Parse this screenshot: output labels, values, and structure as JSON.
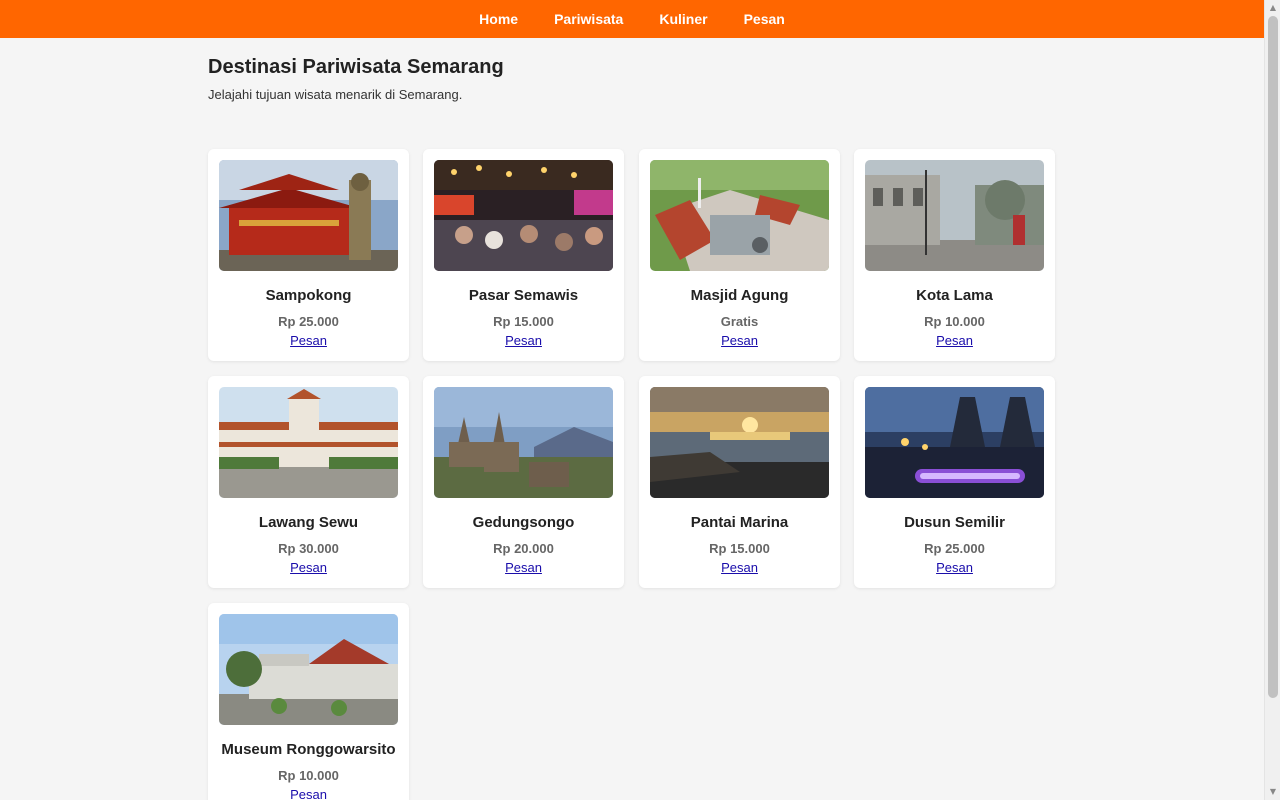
{
  "nav": {
    "items": [
      {
        "label": "Home"
      },
      {
        "label": "Pariwisata"
      },
      {
        "label": "Kuliner"
      },
      {
        "label": "Pesan"
      }
    ]
  },
  "header": {
    "title": "Destinasi Pariwisata Semarang",
    "subtitle": "Jelajahi tujuan wisata menarik di Semarang."
  },
  "destinations": [
    {
      "name": "Sampokong",
      "price": "Rp 25.000",
      "action": "Pesan"
    },
    {
      "name": "Pasar Semawis",
      "price": "Rp 15.000",
      "action": "Pesan"
    },
    {
      "name": "Masjid Agung",
      "price": "Gratis",
      "action": "Pesan"
    },
    {
      "name": "Kota Lama",
      "price": "Rp 10.000",
      "action": "Pesan"
    },
    {
      "name": "Lawang Sewu",
      "price": "Rp 30.000",
      "action": "Pesan"
    },
    {
      "name": "Gedungsongo",
      "price": "Rp 20.000",
      "action": "Pesan"
    },
    {
      "name": "Pantai Marina",
      "price": "Rp 15.000",
      "action": "Pesan"
    },
    {
      "name": "Dusun Semilir",
      "price": "Rp 25.000",
      "action": "Pesan"
    },
    {
      "name": "Museum Ronggowarsito",
      "price": "Rp 10.000",
      "action": "Pesan"
    }
  ],
  "colors": {
    "accent": "#ff6600",
    "link": "#1a0dab"
  }
}
